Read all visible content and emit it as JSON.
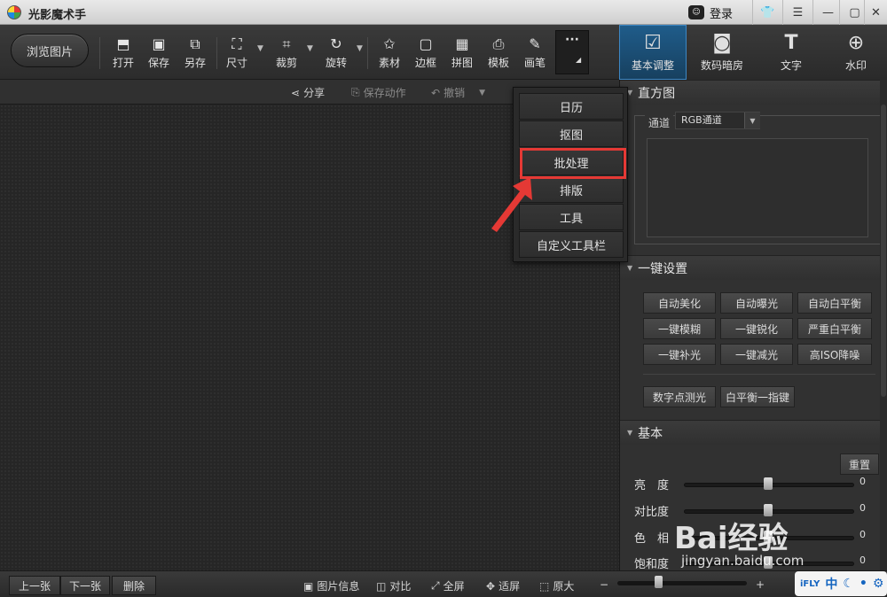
{
  "window": {
    "title": "光影魔术手",
    "login_label": "登录"
  },
  "toolbar": {
    "browse_label": "浏览图片",
    "tools": [
      {
        "label": "打开",
        "icon": "open-icon"
      },
      {
        "label": "保存",
        "icon": "save-icon"
      },
      {
        "label": "另存",
        "icon": "save-as-icon"
      },
      {
        "label": "尺寸",
        "icon": "resize-icon"
      },
      {
        "label": "裁剪",
        "icon": "crop-icon"
      },
      {
        "label": "旋转",
        "icon": "rotate-icon"
      },
      {
        "label": "素材",
        "icon": "material-icon"
      },
      {
        "label": "边框",
        "icon": "border-icon"
      },
      {
        "label": "拼图",
        "icon": "collage-icon"
      },
      {
        "label": "模板",
        "icon": "template-icon"
      },
      {
        "label": "画笔",
        "icon": "brush-icon"
      }
    ],
    "more_label": "···"
  },
  "subbar": {
    "share": "分享",
    "save_action": "保存动作",
    "undo": "撤销"
  },
  "modes": [
    {
      "label": "基本调整",
      "icon": "basic-adjust-icon"
    },
    {
      "label": "数码暗房",
      "icon": "darkroom-icon"
    },
    {
      "label": "文字",
      "icon": "text-icon"
    },
    {
      "label": "水印",
      "icon": "watermark-icon"
    }
  ],
  "histogram": {
    "title": "直方图",
    "channel_label": "通道",
    "channel_value": "RGB通道"
  },
  "one_key": {
    "title": "一键设置",
    "buttons": [
      "自动美化",
      "自动曝光",
      "自动白平衡",
      "一键模糊",
      "一键锐化",
      "严重白平衡",
      "一键补光",
      "一键减光",
      "高ISO降噪"
    ],
    "extra": [
      "数字点测光",
      "白平衡一指键"
    ]
  },
  "basic": {
    "title": "基本",
    "reset_label": "重置",
    "sliders": [
      {
        "label": "亮　度",
        "value": "0"
      },
      {
        "label": "对比度",
        "value": "0"
      },
      {
        "label": "色　相",
        "value": "0"
      },
      {
        "label": "饱和度",
        "value": "0"
      }
    ]
  },
  "menu": {
    "items": [
      "日历",
      "抠图",
      "批处理",
      "排版",
      "工具",
      "自定义工具栏"
    ]
  },
  "bottom": {
    "prev": "上一张",
    "next": "下一张",
    "delete": "删除",
    "info": "图片信息",
    "compare": "对比",
    "fullscreen": "全屏",
    "fit": "适屏",
    "original": "原大",
    "minus": "−",
    "plus": "+"
  },
  "watermark": {
    "brand": "Bai经验",
    "url": "jingyan.baidu.com"
  },
  "ime": {
    "brand": "iFLY",
    "mode": "中"
  },
  "colors": {
    "accent": "#3d87c4",
    "highlight": "#e53935"
  }
}
